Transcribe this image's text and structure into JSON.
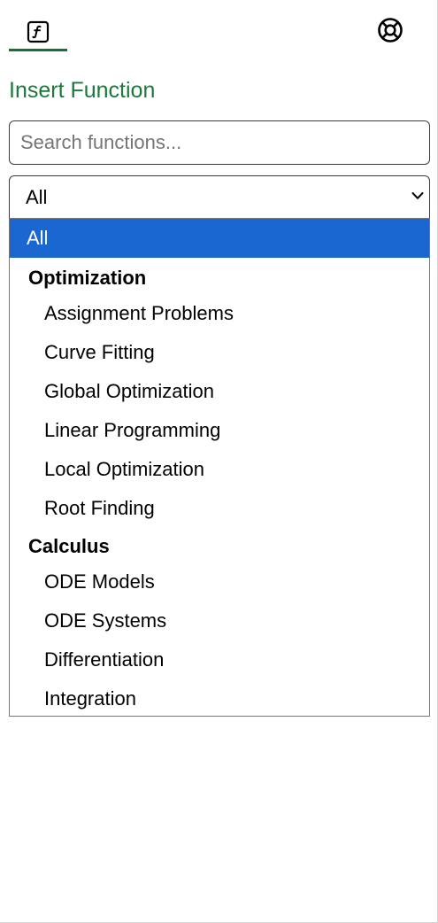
{
  "tabs": [
    {
      "id": "functions",
      "icon": "function-icon",
      "active": true
    },
    {
      "id": "help",
      "icon": "lifebuoy-icon",
      "active": false
    }
  ],
  "accent_color": "#137333",
  "title": "Insert Function",
  "search": {
    "placeholder": "Search functions...",
    "value": ""
  },
  "category_select": {
    "selected": "All",
    "options": [
      {
        "label": "All",
        "kind": "option",
        "selected": true
      },
      {
        "label": "Optimization",
        "kind": "group"
      },
      {
        "label": "Assignment Problems",
        "kind": "option"
      },
      {
        "label": "Curve Fitting",
        "kind": "option"
      },
      {
        "label": "Global Optimization",
        "kind": "option"
      },
      {
        "label": "Linear Programming",
        "kind": "option"
      },
      {
        "label": "Local Optimization",
        "kind": "option"
      },
      {
        "label": "Root Finding",
        "kind": "option"
      },
      {
        "label": "Calculus",
        "kind": "group"
      },
      {
        "label": "ODE Models",
        "kind": "option"
      },
      {
        "label": "ODE Systems",
        "kind": "option"
      },
      {
        "label": "Differentiation",
        "kind": "option"
      },
      {
        "label": "Integration",
        "kind": "option"
      }
    ]
  },
  "highlight_color": "#1a67d2"
}
